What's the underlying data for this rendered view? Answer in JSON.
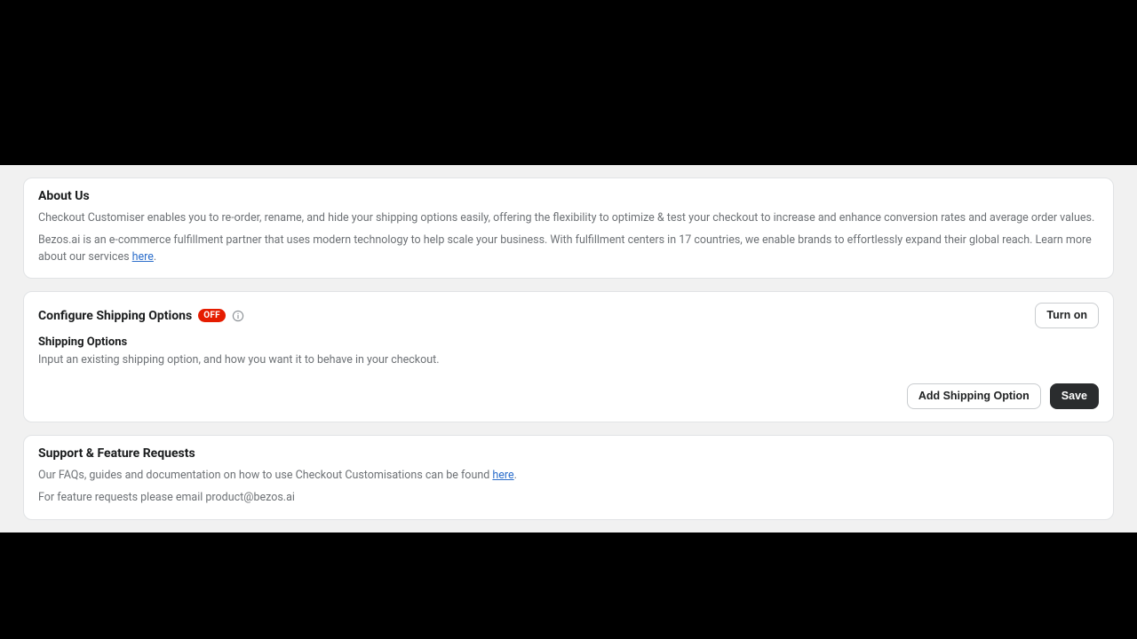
{
  "about": {
    "title": "About Us",
    "p1": "Checkout Customiser enables you to re-order, rename, and hide your shipping options easily, offering the flexibility to optimize & test your checkout to increase and enhance conversion rates and average order values.",
    "p2_a": "Bezos.ai is an e-commerce fulfillment partner that uses modern technology to help scale your business. With fulfillment centers in 17 countries, we enable brands to effortlessly expand their global reach. Learn more about our services ",
    "p2_link": "here",
    "p2_b": "."
  },
  "config": {
    "title": "Configure Shipping Options",
    "badge": "OFF",
    "turn_on_label": "Turn on",
    "sub_title": "Shipping Options",
    "sub_desc": "Input an existing shipping option, and how you want it to behave in your checkout.",
    "add_label": "Add Shipping Option",
    "save_label": "Save"
  },
  "support": {
    "title": "Support & Feature Requests",
    "p1_a": "Our FAQs, guides and documentation on how to use Checkout Customisations can be found ",
    "p1_link": "here",
    "p1_b": ".",
    "p2": "For feature requests please email product@bezos.ai"
  }
}
